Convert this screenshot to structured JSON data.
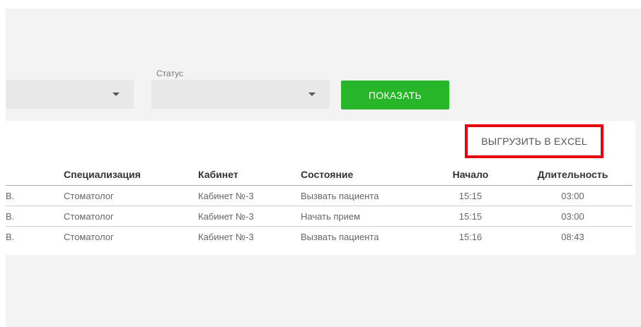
{
  "filters": {
    "status_label": "Статус",
    "show_button": "ПОКАЗАТЬ"
  },
  "export": {
    "label": "ВЫГРУЗИТЬ В EXCEL"
  },
  "table": {
    "headers": [
      "",
      "Специализация",
      "Кабинет",
      "Состояние",
      "Начало",
      "Длительность"
    ],
    "rows": [
      [
        "В.",
        "Стоматолог",
        "Кабинет №-3",
        "Вызвать пациента",
        "15:15",
        "03:00"
      ],
      [
        "В.",
        "Стоматолог",
        "Кабинет №-3",
        "Начать прием",
        "15:15",
        "03:00"
      ],
      [
        "В.",
        "Стоматолог",
        "Кабинет №-3",
        "Вызвать пациента",
        "15:16",
        "08:43"
      ]
    ]
  },
  "colors": {
    "accent_green": "#27b62a",
    "highlight_red": "#e6000e",
    "background": "#f3f3f3"
  },
  "icons": [
    "chevron-down-icon"
  ]
}
